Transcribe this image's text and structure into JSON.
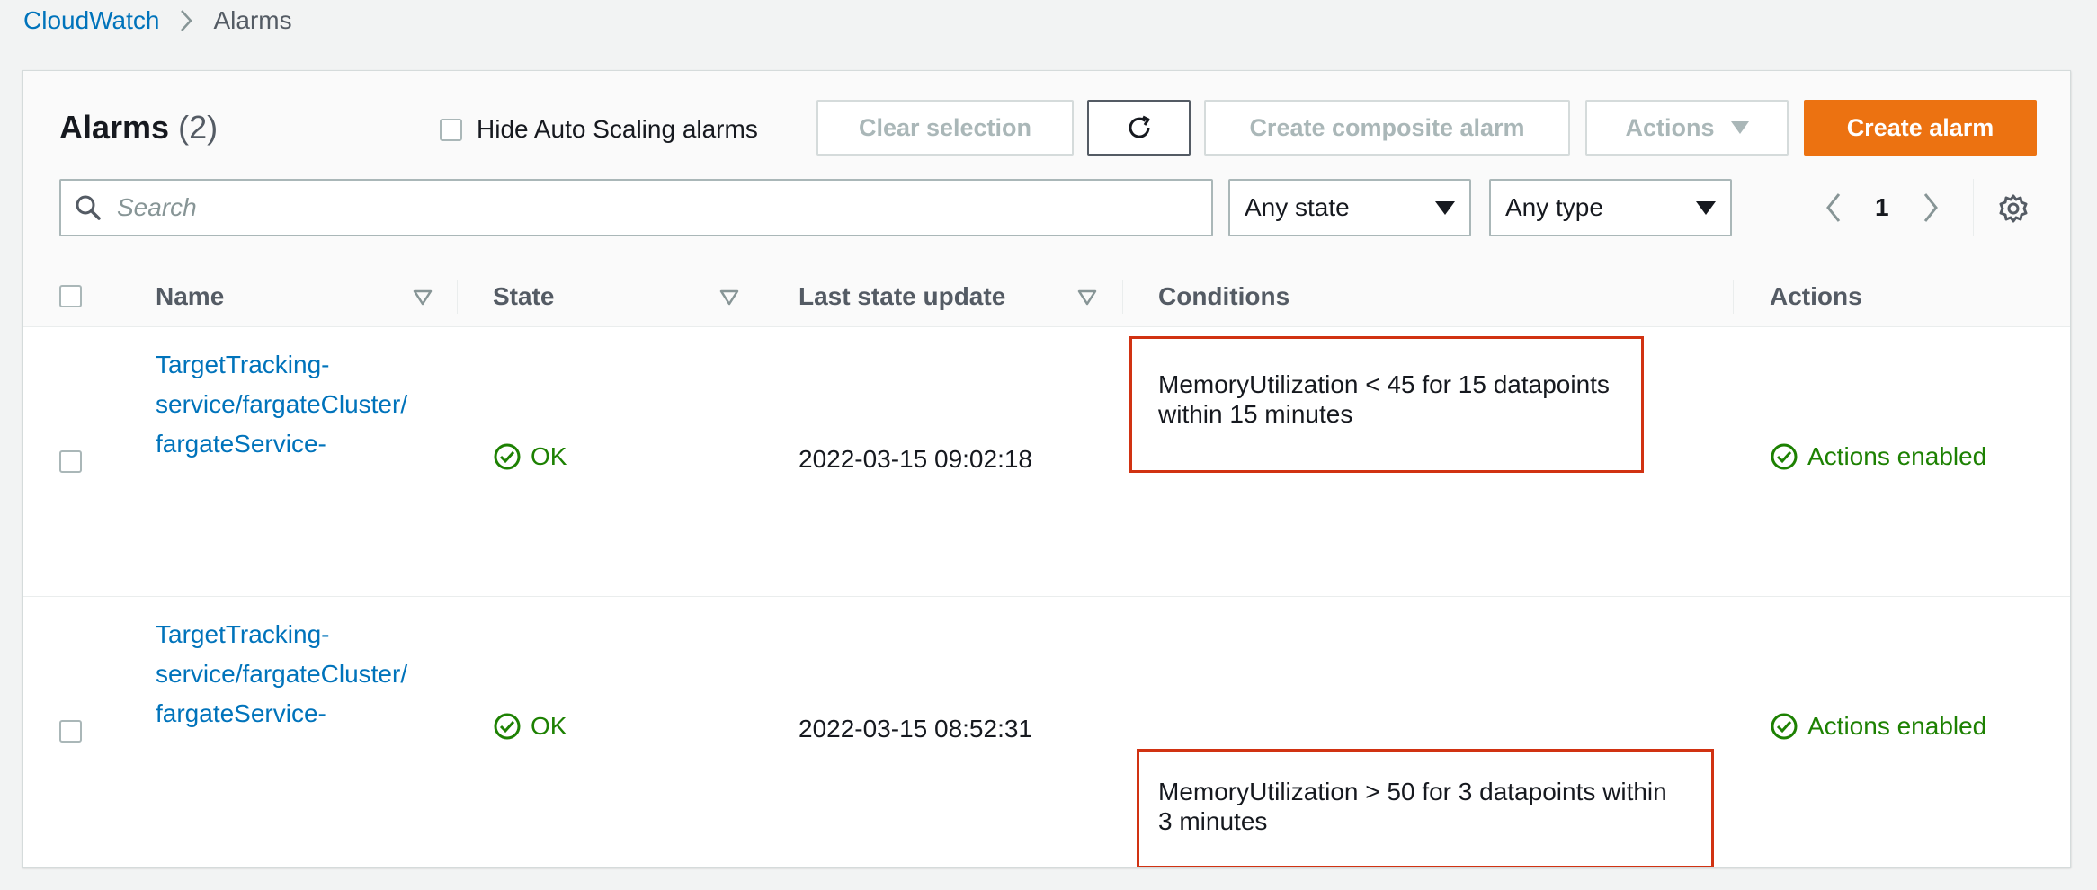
{
  "breadcrumb": {
    "root": "CloudWatch",
    "current": "Alarms"
  },
  "header": {
    "title": "Alarms",
    "count": "(2)",
    "hide_autoscaling_label": "Hide Auto Scaling alarms",
    "buttons": {
      "clear_selection": "Clear selection",
      "create_composite": "Create composite alarm",
      "actions": "Actions",
      "create_alarm": "Create alarm"
    }
  },
  "filters": {
    "search_placeholder": "Search",
    "state": "Any state",
    "type": "Any type",
    "page": "1"
  },
  "columns": {
    "name": "Name",
    "state": "State",
    "last_update": "Last state update",
    "conditions": "Conditions",
    "actions": "Actions"
  },
  "rows": [
    {
      "name_line1": "TargetTracking-",
      "name_line2": "service/fargateCluster/",
      "name_line3": "fargateService-",
      "state": "OK",
      "last_update": "2022-03-15 09:02:18",
      "condition_line1": "MemoryUtilization < 45 for 15 datapoints",
      "condition_line2": "within 15 minutes",
      "actions": "Actions enabled"
    },
    {
      "name_line1": "TargetTracking-",
      "name_line2": "service/fargateCluster/",
      "name_line3": "fargateService-",
      "state": "OK",
      "last_update": "2022-03-15 08:52:31",
      "condition_line1": "MemoryUtilization > 50 for 3 datapoints within",
      "condition_line2": "3 minutes",
      "actions": "Actions enabled"
    }
  ],
  "colors": {
    "link": "#0073bb",
    "primary": "#ec7211",
    "success": "#1d8102",
    "highlight": "#d13212"
  }
}
